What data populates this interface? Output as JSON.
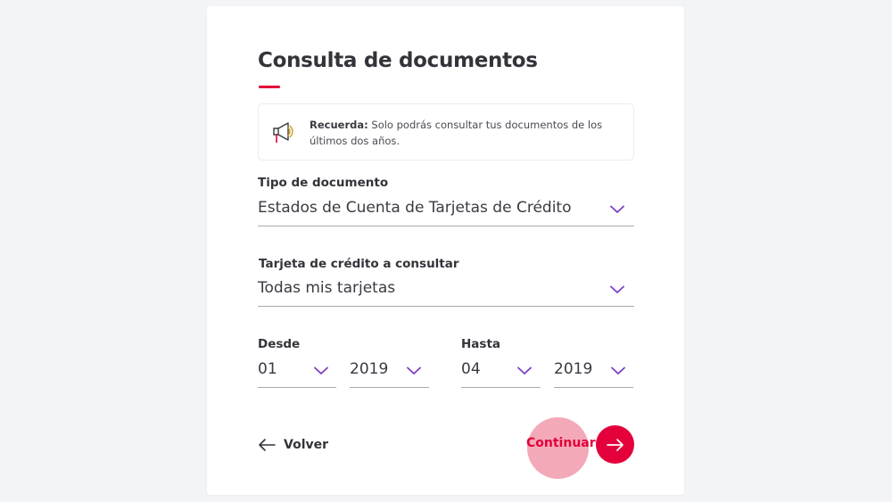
{
  "page": {
    "title": "Consulta de documentos"
  },
  "notice": {
    "icon": "megaphone-icon",
    "bold": "Recuerda:",
    "text": " Solo podrás consultar tus documentos de los últimos dos años."
  },
  "document_type": {
    "label": "Tipo de documento",
    "value": "Estados de Cuenta de Tarjetas de Crédito"
  },
  "card_select": {
    "label": "Tarjeta de crédito a consultar",
    "value": "Todas mis tarjetas"
  },
  "from": {
    "label": "Desde",
    "month": "01",
    "year": "2019"
  },
  "to": {
    "label": "Hasta",
    "month": "04",
    "year": "2019"
  },
  "actions": {
    "back_label": "Volver",
    "continue_label": "Continuar"
  },
  "colors": {
    "accent": "#e4003a",
    "chevron": "#7b3fc4",
    "ripple": "#f4a9b8"
  }
}
